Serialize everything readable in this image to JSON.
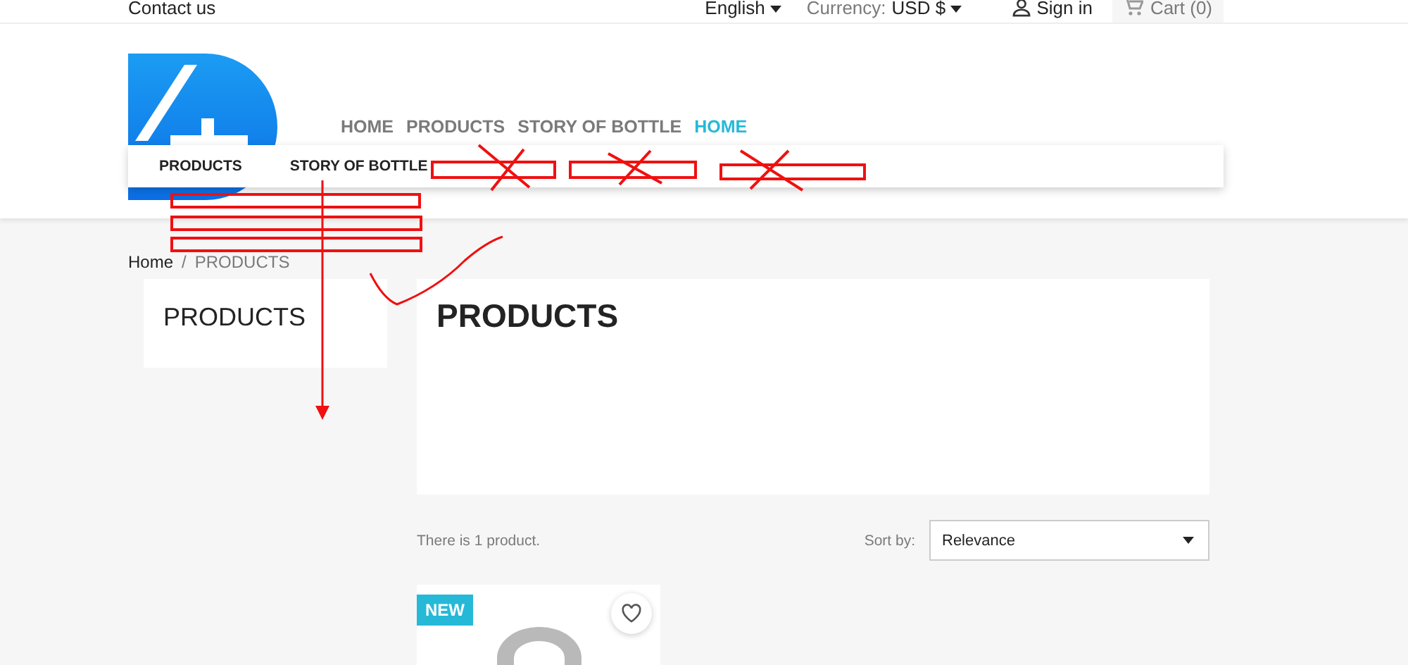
{
  "topbar": {
    "contact": "Contact us",
    "language": "English",
    "currency_label": "Currency:",
    "currency_value": "USD $",
    "sign_in": "Sign in",
    "cart": "Cart (0)"
  },
  "main_menu": [
    {
      "label": "HOME",
      "selected": false
    },
    {
      "label": "PRODUCTS",
      "selected": false
    },
    {
      "label": "STORY OF BOTTLE",
      "selected": false
    },
    {
      "label": "HOME",
      "selected": true
    }
  ],
  "submenu": [
    "PRODUCTS",
    "STORY OF BOTTLE"
  ],
  "breadcrumb_separator": "/",
  "breadcrumb": [
    {
      "label": "Home",
      "current": false
    },
    {
      "label": "PRODUCTS",
      "current": true
    }
  ],
  "sidebar": {
    "title": "PRODUCTS"
  },
  "category": {
    "title": "PRODUCTS"
  },
  "listing": {
    "count": "There is 1 product.",
    "sort_label": "Sort by:",
    "sort_value": "Relevance"
  },
  "products": [
    {
      "flag": "NEW"
    }
  ]
}
